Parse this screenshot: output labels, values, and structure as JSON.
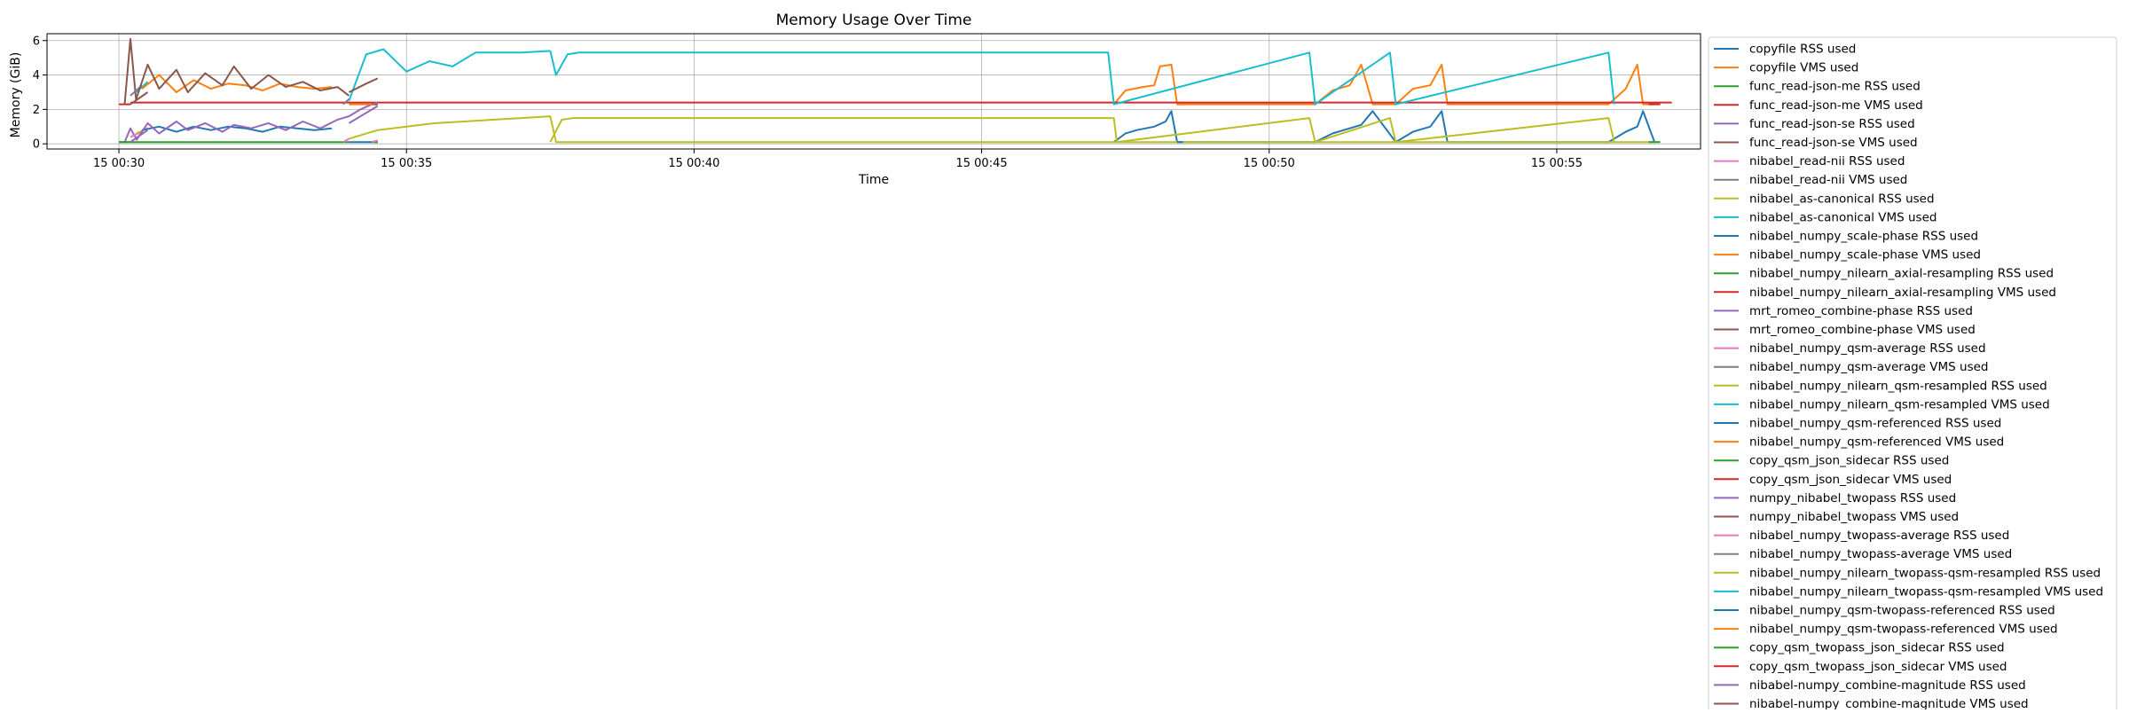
{
  "chart_data": {
    "type": "line",
    "title": "Memory Usage Over Time",
    "xlabel": "Time",
    "ylabel": "Memory (GiB)",
    "x_unit": "minute",
    "x_domain": "15 00:28:45 to 15 00:57:30",
    "xlim": [
      28.75,
      57.5
    ],
    "ylim": [
      -0.3,
      6.4
    ],
    "xticks": [
      {
        "value": 30,
        "label": "15 00:30"
      },
      {
        "value": 35,
        "label": "15 00:35"
      },
      {
        "value": 40,
        "label": "15 00:40"
      },
      {
        "value": 45,
        "label": "15 00:45"
      },
      {
        "value": 50,
        "label": "15 00:50"
      },
      {
        "value": 55,
        "label": "15 00:55"
      }
    ],
    "yticks": [
      {
        "value": 0,
        "label": "0"
      },
      {
        "value": 2,
        "label": "2"
      },
      {
        "value": 4,
        "label": "4"
      },
      {
        "value": 6,
        "label": "6"
      }
    ],
    "grid": true,
    "legend_position": "outside-right",
    "palette": [
      "#1f77b4",
      "#ff7f0e",
      "#2ca02c",
      "#d62728",
      "#9467bd",
      "#8c564b",
      "#e377c2",
      "#7f7f7f",
      "#bcbd22",
      "#17becf"
    ],
    "series": [
      {
        "name": "copyfile RSS used",
        "color": "#1f77b4",
        "x": [
          47.3,
          47.5,
          47.7,
          48.0,
          48.2,
          48.3,
          48.4,
          50.8,
          51.1,
          51.4,
          51.6,
          51.8,
          52.2,
          52.5,
          52.8,
          53.0,
          53.1,
          55.9,
          56.2,
          56.4,
          56.5,
          56.7
        ],
        "y": [
          0.1,
          0.6,
          0.8,
          1.0,
          1.3,
          1.9,
          0.1,
          0.1,
          0.6,
          0.9,
          1.1,
          1.9,
          0.1,
          0.7,
          1.0,
          1.9,
          0.1,
          0.1,
          0.7,
          1.0,
          1.9,
          0.1
        ]
      },
      {
        "name": "copyfile VMS used",
        "color": "#ff7f0e",
        "x": [
          47.3,
          47.5,
          47.8,
          48.0,
          48.1,
          48.3,
          48.4,
          50.8,
          51.1,
          51.4,
          51.6,
          51.8,
          52.2,
          52.5,
          52.8,
          53.0,
          53.1,
          55.9,
          56.2,
          56.4,
          56.5,
          56.7
        ],
        "y": [
          2.3,
          3.1,
          3.3,
          3.4,
          4.5,
          4.6,
          2.3,
          2.3,
          3.1,
          3.4,
          4.6,
          2.3,
          2.3,
          3.2,
          3.4,
          4.6,
          2.3,
          2.3,
          3.2,
          4.6,
          2.3,
          2.3
        ]
      },
      {
        "name": "func_read-json-me RSS used",
        "color": "#2ca02c",
        "x": [
          30.0,
          30.2
        ],
        "y": [
          0.1,
          0.1
        ]
      },
      {
        "name": "func_read-json-me VMS used",
        "color": "#d62728",
        "x": [
          30.0,
          30.2
        ],
        "y": [
          2.3,
          2.3
        ]
      },
      {
        "name": "func_read-json-se RSS used",
        "color": "#9467bd",
        "x": [
          30.1,
          30.2,
          30.3
        ],
        "y": [
          0.1,
          0.9,
          0.3
        ]
      },
      {
        "name": "func_read-json-se VMS used",
        "color": "#8c564b",
        "x": [
          30.1,
          30.2,
          30.3
        ],
        "y": [
          2.3,
          6.1,
          2.5
        ]
      },
      {
        "name": "nibabel_read-nii RSS used",
        "color": "#e377c2",
        "x": [
          30.2,
          30.4
        ],
        "y": [
          0.4,
          0.7
        ]
      },
      {
        "name": "nibabel_read-nii VMS used",
        "color": "#7f7f7f",
        "x": [
          30.2,
          30.4
        ],
        "y": [
          2.8,
          3.4
        ]
      },
      {
        "name": "nibabel_as-canonical RSS used",
        "color": "#bcbd22",
        "x": [
          30.3,
          30.5
        ],
        "y": [
          0.6,
          0.9
        ]
      },
      {
        "name": "nibabel_as-canonical VMS used",
        "color": "#17becf",
        "x": [
          30.3,
          30.5
        ],
        "y": [
          3.0,
          3.6
        ]
      },
      {
        "name": "nibabel_numpy_scale-phase RSS used",
        "color": "#1f77b4",
        "x": [
          30.4,
          30.7,
          31.0,
          31.3,
          31.6,
          31.9,
          32.2,
          32.5,
          32.8,
          33.1,
          33.4,
          33.7
        ],
        "y": [
          0.8,
          1.0,
          0.7,
          1.0,
          0.8,
          1.0,
          0.9,
          0.7,
          1.0,
          0.9,
          0.8,
          0.9
        ]
      },
      {
        "name": "nibabel_numpy_scale-phase VMS used",
        "color": "#ff7f0e",
        "x": [
          30.4,
          30.7,
          31.0,
          31.3,
          31.6,
          31.9,
          32.2,
          32.5,
          32.8,
          33.1,
          33.4,
          33.7
        ],
        "y": [
          3.2,
          4.0,
          3.0,
          3.7,
          3.2,
          3.5,
          3.4,
          3.1,
          3.5,
          3.3,
          3.2,
          3.3
        ]
      },
      {
        "name": "nibabel_numpy_nilearn_axial-resampling RSS used",
        "color": "#2ca02c",
        "x": [
          30.0,
          34.0
        ],
        "y": [
          0.1,
          0.1
        ]
      },
      {
        "name": "nibabel_numpy_nilearn_axial-resampling VMS used",
        "color": "#d62728",
        "x": [
          30.2,
          57.0
        ],
        "y": [
          2.4,
          2.4
        ]
      },
      {
        "name": "mrt_romeo_combine-phase RSS used",
        "color": "#9467bd",
        "x": [
          30.3,
          30.5,
          30.7,
          31.0,
          31.2,
          31.5,
          31.8,
          32.0,
          32.3,
          32.6,
          32.9,
          33.2,
          33.5,
          33.8,
          34.0,
          34.2,
          34.4
        ],
        "y": [
          0.2,
          1.2,
          0.6,
          1.3,
          0.8,
          1.2,
          0.7,
          1.1,
          0.9,
          1.2,
          0.8,
          1.3,
          0.9,
          1.4,
          1.6,
          2.0,
          2.3
        ]
      },
      {
        "name": "mrt_romeo_combine-phase VMS used",
        "color": "#8c564b",
        "x": [
          30.3,
          30.5,
          30.7,
          31.0,
          31.2,
          31.5,
          31.8,
          32.0,
          32.3,
          32.6,
          32.9,
          33.2,
          33.5,
          33.8,
          34.0
        ],
        "y": [
          2.6,
          4.6,
          3.2,
          4.3,
          3.0,
          4.1,
          3.4,
          4.5,
          3.2,
          4.0,
          3.3,
          3.6,
          3.1,
          3.3,
          2.8
        ]
      },
      {
        "name": "nibabel_numpy_qsm-average RSS used",
        "color": "#e377c2",
        "x": [
          33.9,
          34.0
        ],
        "y": [
          0.1,
          0.3
        ]
      },
      {
        "name": "nibabel_numpy_qsm-average VMS used",
        "color": "#7f7f7f",
        "x": [
          33.9,
          34.0
        ],
        "y": [
          2.3,
          2.6
        ]
      },
      {
        "name": "nibabel_numpy_nilearn_qsm-resampled RSS used",
        "color": "#bcbd22",
        "x": [
          34.0,
          34.5,
          35.0,
          35.5,
          36.0,
          36.5,
          37.0,
          37.5,
          37.6,
          56.7
        ],
        "y": [
          0.3,
          0.8,
          1.0,
          1.2,
          1.3,
          1.4,
          1.5,
          1.6,
          0.1,
          0.1
        ]
      },
      {
        "name": "nibabel_numpy_nilearn_qsm-resampled VMS used",
        "color": "#17becf",
        "x": [
          34.0,
          34.3,
          34.6,
          35.0,
          35.4,
          35.8,
          36.2,
          36.6,
          37.0,
          37.5
        ],
        "y": [
          2.5,
          5.2,
          5.5,
          4.2,
          4.8,
          4.5,
          5.3,
          5.3,
          5.3,
          5.4
        ]
      },
      {
        "name": "nibabel_numpy_qsm-referenced RSS used",
        "color": "#1f77b4",
        "x": [
          34.0,
          34.5
        ],
        "y": [
          0.1,
          0.1
        ]
      },
      {
        "name": "nibabel_numpy_qsm-referenced VMS used",
        "color": "#ff7f0e",
        "x": [
          34.0,
          34.5
        ],
        "y": [
          2.3,
          2.3
        ]
      },
      {
        "name": "copy_qsm_json_sidecar RSS used",
        "color": "#2ca02c",
        "x": [
          34.4,
          34.5
        ],
        "y": [
          0.1,
          0.1
        ]
      },
      {
        "name": "copy_qsm_json_sidecar VMS used",
        "color": "#d62728",
        "x": [
          34.4,
          34.5
        ],
        "y": [
          2.3,
          2.3
        ]
      },
      {
        "name": "numpy_nibabel_twopass RSS used",
        "color": "#9467bd",
        "x": [
          34.0,
          34.3,
          34.5
        ],
        "y": [
          1.2,
          1.8,
          2.2
        ]
      },
      {
        "name": "numpy_nibabel_twopass VMS used",
        "color": "#8c564b",
        "x": [
          34.0,
          34.3,
          34.5
        ],
        "y": [
          3.0,
          3.5,
          3.8
        ]
      },
      {
        "name": "nibabel_numpy_twopass-average RSS used",
        "color": "#e377c2",
        "x": [
          34.4,
          34.5
        ],
        "y": [
          0.1,
          0.2
        ]
      },
      {
        "name": "nibabel_numpy_twopass-average VMS used",
        "color": "#7f7f7f",
        "x": [
          34.4,
          34.5
        ],
        "y": [
          2.3,
          2.4
        ]
      },
      {
        "name": "nibabel_numpy_nilearn_twopass-qsm-resampled RSS used",
        "color": "#bcbd22",
        "x": [
          37.5,
          37.7,
          37.9,
          47.3,
          47.35,
          50.7,
          50.8,
          52.1,
          52.2,
          55.9,
          56.0
        ],
        "y": [
          0.1,
          1.4,
          1.5,
          1.5,
          0.1,
          1.5,
          0.1,
          1.5,
          0.1,
          1.5,
          0.1
        ]
      },
      {
        "name": "nibabel_numpy_nilearn_twopass-qsm-resampled VMS used",
        "color": "#17becf",
        "x": [
          37.5,
          37.6,
          37.8,
          38.0,
          47.2,
          47.3,
          50.7,
          50.8,
          52.1,
          52.2,
          55.9,
          56.0
        ],
        "y": [
          5.4,
          4.0,
          5.2,
          5.3,
          5.3,
          2.3,
          5.3,
          2.3,
          5.3,
          2.3,
          5.3,
          2.3
        ]
      },
      {
        "name": "nibabel_numpy_qsm-twopass-referenced RSS used",
        "color": "#1f77b4",
        "x": [
          48.4,
          48.5
        ],
        "y": [
          0.1,
          0.1
        ]
      },
      {
        "name": "nibabel_numpy_qsm-twopass-referenced VMS used",
        "color": "#ff7f0e",
        "x": [
          48.4,
          48.5
        ],
        "y": [
          2.3,
          2.3
        ]
      },
      {
        "name": "copy_qsm_twopass_json_sidecar RSS used",
        "color": "#2ca02c",
        "x": [
          56.6,
          56.8
        ],
        "y": [
          0.1,
          0.1
        ]
      },
      {
        "name": "copy_qsm_twopass_json_sidecar VMS used",
        "color": "#d62728",
        "x": [
          56.6,
          56.8
        ],
        "y": [
          2.3,
          2.3
        ]
      },
      {
        "name": "nibabel-numpy_combine-magnitude RSS used",
        "color": "#9467bd",
        "x": [
          30.2,
          30.5
        ],
        "y": [
          0.1,
          0.8
        ]
      },
      {
        "name": "nibabel-numpy_combine-magnitude VMS used",
        "color": "#8c564b",
        "x": [
          30.2,
          30.5
        ],
        "y": [
          2.3,
          3.0
        ]
      }
    ]
  }
}
